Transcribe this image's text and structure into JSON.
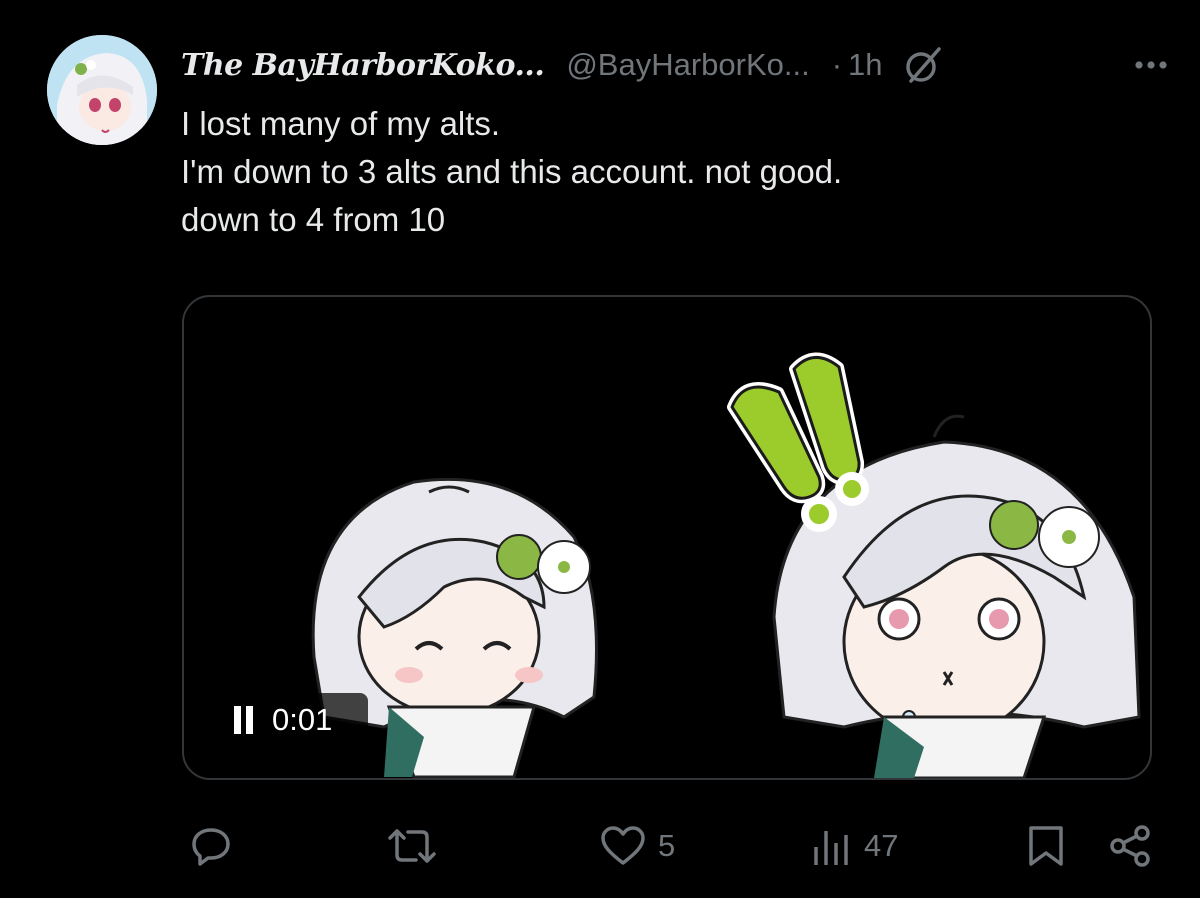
{
  "post": {
    "display_name": "The BayHarborKoko...",
    "handle": "@BayHarborKo...",
    "separator": "·",
    "time": "1h",
    "icons": {
      "avatar": "avatar-image",
      "grok": "grok-icon",
      "more": "more-icon"
    },
    "text_lines": [
      "I lost many of my alts.",
      "I'm down to 3 alts and this account. not good.",
      "down to 4 from 10"
    ]
  },
  "media": {
    "type": "video",
    "timer": "0:01",
    "pause_icon": "pause-icon",
    "colors": {
      "exclaim": "#9ccc2c",
      "hair": "#e8e8ee",
      "leaf": "#8bb845",
      "coat": "#2f6e60"
    }
  },
  "actions": {
    "reply": {
      "icon": "reply-icon",
      "count": ""
    },
    "repost": {
      "icon": "repost-icon",
      "count": ""
    },
    "like": {
      "icon": "heart-icon",
      "count": "5"
    },
    "views": {
      "icon": "views-icon",
      "count": "47"
    },
    "bookmark": {
      "icon": "bookmark-icon"
    },
    "share": {
      "icon": "share-icon"
    }
  },
  "colors": {
    "background": "#000000",
    "text": "#e7e9ea",
    "muted": "#71767b",
    "border": "#333639"
  }
}
